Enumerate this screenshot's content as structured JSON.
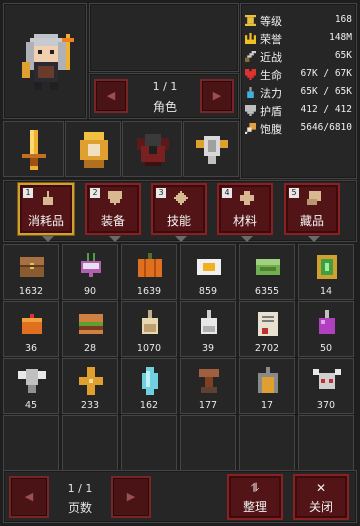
{
  "character": {
    "pager": {
      "page": "1 / 1",
      "label": "角色",
      "prev": "◀",
      "next": "▶"
    }
  },
  "stats": [
    {
      "label": "等级",
      "value": "168",
      "icon": "hourglass-icon",
      "color": "#e8c040"
    },
    {
      "label": "荣誉",
      "value": "148M",
      "icon": "crown-icon",
      "color": "#f0c020"
    },
    {
      "label": "近战",
      "value": "65K",
      "icon": "sword-icon",
      "color": "#d0d0d0"
    },
    {
      "label": "生命",
      "value": "67K / 67K",
      "icon": "heart-icon",
      "color": "#e03030"
    },
    {
      "label": "法力",
      "value": "65K / 65K",
      "icon": "mana-potion-icon",
      "color": "#40b0e0"
    },
    {
      "label": "护盾",
      "value": "412 / 412",
      "icon": "shield-icon",
      "color": "#c0c0c0"
    },
    {
      "label": "饱腹",
      "value": "5646/6810",
      "icon": "drumstick-icon",
      "color": "#e0a040"
    }
  ],
  "categories": [
    {
      "num": "1",
      "label": "消耗品",
      "icon": "flask-icon",
      "active": true
    },
    {
      "num": "2",
      "label": "装备",
      "icon": "shield-icon",
      "active": false
    },
    {
      "num": "3",
      "label": "技能",
      "icon": "diamond-icon",
      "active": false
    },
    {
      "num": "4",
      "label": "材料",
      "icon": "cross-icon",
      "active": false
    },
    {
      "num": "5",
      "label": "藏品",
      "icon": "scroll-icon",
      "active": false
    }
  ],
  "inventory": [
    {
      "qty": "1632",
      "icon": "treasure-chest-icon"
    },
    {
      "qty": "90",
      "icon": "turnip-icon"
    },
    {
      "qty": "1639",
      "icon": "pumpkin-icon"
    },
    {
      "qty": "859",
      "icon": "fried-egg-icon"
    },
    {
      "qty": "6355",
      "icon": "green-cake-icon"
    },
    {
      "qty": "14",
      "icon": "emerald-badge-icon"
    },
    {
      "qty": "36",
      "icon": "orange-cake-icon"
    },
    {
      "qty": "28",
      "icon": "burger-icon"
    },
    {
      "qty": "1070",
      "icon": "tan-potion-icon"
    },
    {
      "qty": "39",
      "icon": "white-potion-icon"
    },
    {
      "qty": "2702",
      "icon": "scroll-page-icon"
    },
    {
      "qty": "50",
      "icon": "purple-potion-icon"
    },
    {
      "qty": "45",
      "icon": "winged-totem-icon"
    },
    {
      "qty": "233",
      "icon": "gold-cross-icon"
    },
    {
      "qty": "162",
      "icon": "crystal-icon"
    },
    {
      "qty": "177",
      "icon": "anvil-icon"
    },
    {
      "qty": "17",
      "icon": "arch-gate-icon"
    },
    {
      "qty": "370",
      "icon": "horned-skull-icon"
    }
  ],
  "bottom": {
    "page": "1 / 1",
    "label": "页数",
    "prev": "◀",
    "next": "▶",
    "sort_icon": "⥮",
    "sort_label": "整理",
    "close_icon": "✕",
    "close_label": "关闭"
  },
  "colors": {
    "accent_red": "#8a2022",
    "active_gold": "#d0a030",
    "panel": "#262626"
  }
}
